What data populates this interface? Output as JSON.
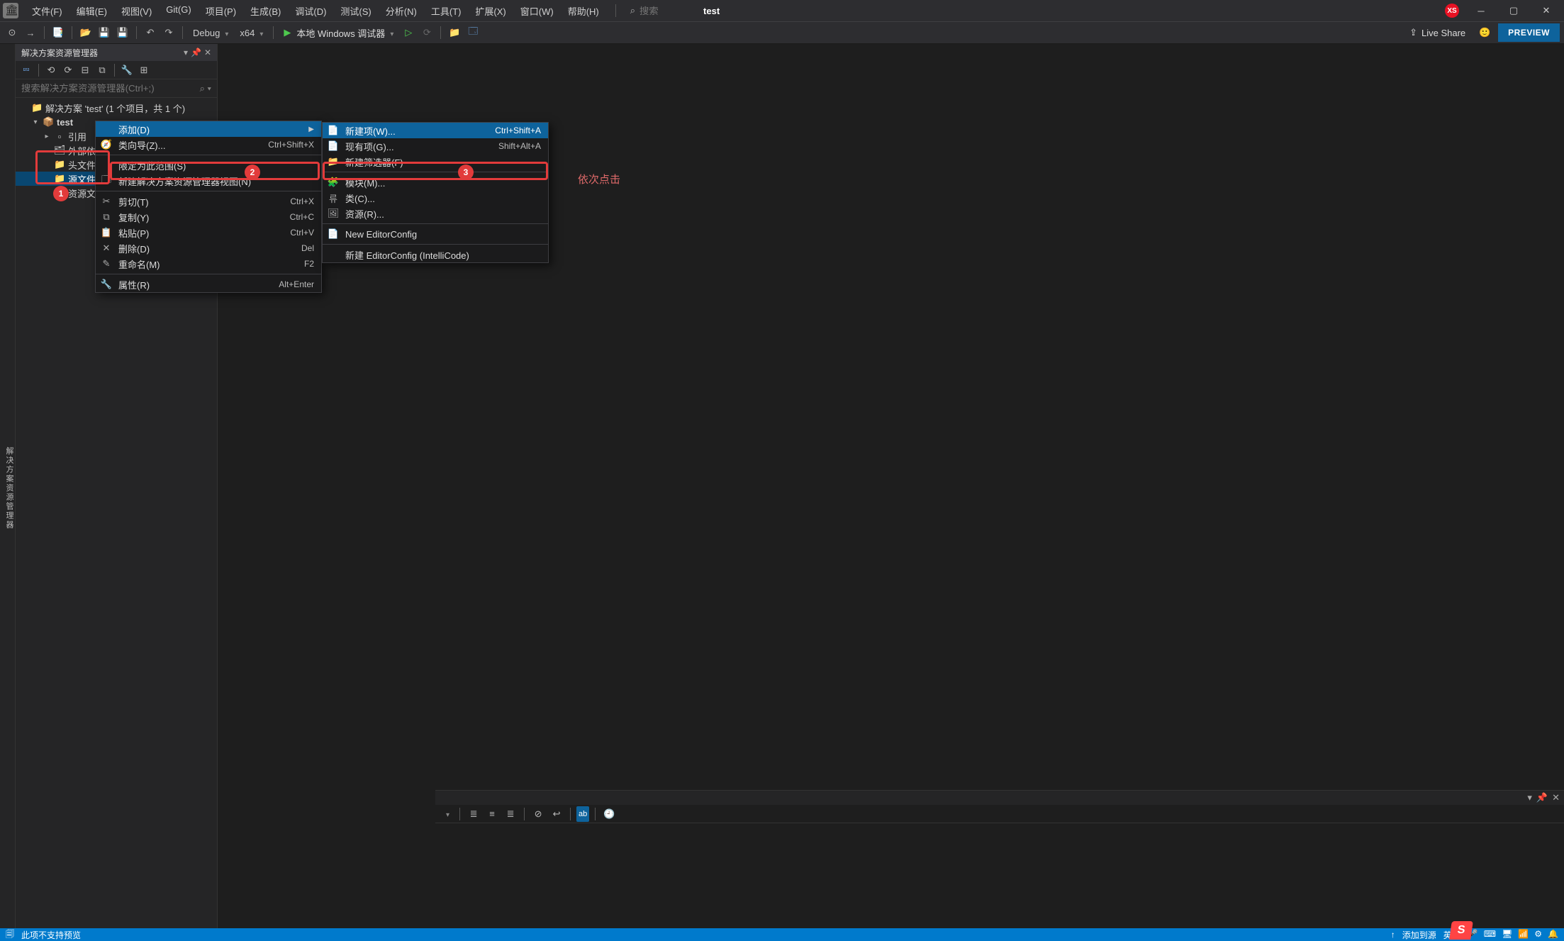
{
  "titlebar": {
    "menus": [
      "文件(F)",
      "编辑(E)",
      "视图(V)",
      "Git(G)",
      "项目(P)",
      "生成(B)",
      "调试(D)",
      "测试(S)",
      "分析(N)",
      "工具(T)",
      "扩展(X)",
      "窗口(W)",
      "帮助(H)"
    ],
    "search_placeholder": "搜索",
    "project_name": "test",
    "avatar_initials": "XS"
  },
  "toolbar": {
    "config_label": "Debug",
    "platform_label": "x64",
    "debugger_label": "本地 Windows 调试器",
    "live_share": "Live Share",
    "preview": "PREVIEW"
  },
  "side_tab_label": "解决方案资源管理器",
  "sidebar": {
    "panel_title": "解决方案资源管理器",
    "search_placeholder": "搜索解决方案资源管理器(Ctrl+;)",
    "tree": [
      {
        "indent": 0,
        "exp": "",
        "ico": "📁",
        "label": "解决方案 'test' (1 个项目，共 1 个)",
        "sel": false,
        "name": "solution-node"
      },
      {
        "indent": 1,
        "exp": "▾",
        "ico": "📦",
        "label": "test",
        "sel": false,
        "bold": true,
        "name": "project-node"
      },
      {
        "indent": 2,
        "exp": "▸",
        "ico": "▫",
        "label": "引用",
        "sel": false,
        "name": "references-node"
      },
      {
        "indent": 2,
        "exp": "",
        "ico": "🗂",
        "label": "外部依赖项",
        "sel": false,
        "name": "external-deps-node"
      },
      {
        "indent": 2,
        "exp": "",
        "ico": "📁",
        "label": "头文件",
        "sel": false,
        "name": "header-files-node"
      },
      {
        "indent": 2,
        "exp": "",
        "ico": "📁",
        "label": "源文件",
        "sel": true,
        "name": "source-files-node"
      },
      {
        "indent": 2,
        "exp": "",
        "ico": "📁",
        "label": "资源文件",
        "sel": false,
        "name": "resource-files-node"
      }
    ]
  },
  "context_menu1": [
    {
      "type": "item",
      "ico": "",
      "label": "添加(D)",
      "short": "",
      "arrow": true,
      "hl": true,
      "name": "ctx-add"
    },
    {
      "type": "item",
      "ico": "🧭",
      "label": "类向导(Z)...",
      "short": "Ctrl+Shift+X",
      "name": "ctx-class-wizard"
    },
    {
      "type": "sep"
    },
    {
      "type": "item",
      "ico": "",
      "label": "限定为此范围(S)",
      "short": "",
      "name": "ctx-scope"
    },
    {
      "type": "item",
      "ico": "🗔",
      "label": "新建解决方案资源管理器视图(N)",
      "short": "",
      "name": "ctx-new-view"
    },
    {
      "type": "sep"
    },
    {
      "type": "item",
      "ico": "✂",
      "label": "剪切(T)",
      "short": "Ctrl+X",
      "name": "ctx-cut"
    },
    {
      "type": "item",
      "ico": "⧉",
      "label": "复制(Y)",
      "short": "Ctrl+C",
      "name": "ctx-copy"
    },
    {
      "type": "item",
      "ico": "📋",
      "label": "粘贴(P)",
      "short": "Ctrl+V",
      "name": "ctx-paste"
    },
    {
      "type": "item",
      "ico": "✕",
      "label": "删除(D)",
      "short": "Del",
      "name": "ctx-delete"
    },
    {
      "type": "item",
      "ico": "✎",
      "label": "重命名(M)",
      "short": "F2",
      "name": "ctx-rename"
    },
    {
      "type": "sep"
    },
    {
      "type": "item",
      "ico": "🔧",
      "label": "属性(R)",
      "short": "Alt+Enter",
      "name": "ctx-properties"
    }
  ],
  "context_menu2": [
    {
      "type": "item",
      "ico": "📄",
      "label": "新建项(W)...",
      "short": "Ctrl+Shift+A",
      "hl": true,
      "name": "ctx-new-item"
    },
    {
      "type": "item",
      "ico": "📄",
      "label": "现有项(G)...",
      "short": "Shift+Alt+A",
      "name": "ctx-existing-item"
    },
    {
      "type": "item",
      "ico": "📁",
      "label": "新建筛选器(F)",
      "short": "",
      "name": "ctx-new-filter"
    },
    {
      "type": "sep"
    },
    {
      "type": "item",
      "ico": "🧩",
      "label": "模块(M)...",
      "short": "",
      "name": "ctx-module"
    },
    {
      "type": "item",
      "ico": "류",
      "label": "类(C)...",
      "short": "",
      "name": "ctx-class"
    },
    {
      "type": "item",
      "ico": "🖼",
      "label": "资源(R)...",
      "short": "",
      "name": "ctx-resource"
    },
    {
      "type": "sep"
    },
    {
      "type": "item",
      "ico": "📄",
      "label": "New EditorConfig",
      "short": "",
      "name": "ctx-new-editorconfig"
    },
    {
      "type": "sep"
    },
    {
      "type": "item",
      "ico": "",
      "label": "新建 EditorConfig (IntelliCode)",
      "short": "",
      "name": "ctx-editorconfig-intellicode"
    }
  ],
  "annotation": {
    "badge1": "1",
    "badge2": "2",
    "badge3": "3",
    "text": "依次点击"
  },
  "statusbar": {
    "left_text": "此项不支持预览",
    "right_text": "添加到源",
    "ime_letter": "S",
    "tray": [
      "英",
      "･",
      "🎤",
      "⌨",
      "🖥",
      "📶",
      "⚙",
      "🔔"
    ]
  }
}
